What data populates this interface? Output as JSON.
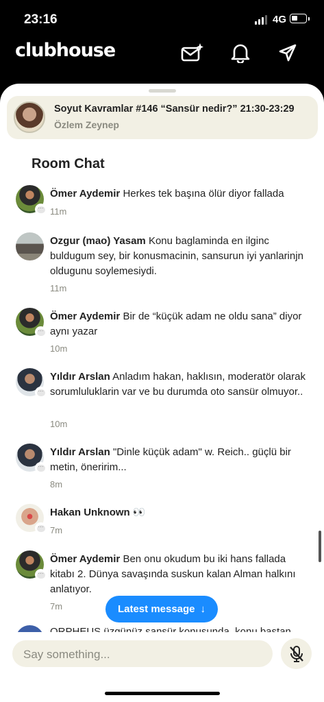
{
  "status": {
    "time": "23:16",
    "network": "4G",
    "battery_level": 0.3
  },
  "app": {
    "logo": "clubhouse"
  },
  "top_icons": [
    "new-message-icon",
    "bell-icon",
    "send-icon"
  ],
  "room": {
    "title": "Soyut Kavramlar #146 “Sansür nedir?” 21:30-23:29",
    "host": "Özlem Zeynep"
  },
  "chat": {
    "heading": "Room Chat",
    "messages": [
      {
        "name": "Ömer Aydemir",
        "text": "Herkes tek başına ölür diyor fallada",
        "time": "11m"
      },
      {
        "name": "Ozgur (mao) Yasam",
        "text": "Konu baglaminda en ilginc buldugum sey, bir konusmacinin, sansurun iyi yanlarinjn oldugunu soylemesiydi.",
        "time": "11m"
      },
      {
        "name": "Ömer Aydemir",
        "text": "Bir de “küçük adam ne oldu sana” diyor aynı yazar",
        "time": "10m"
      },
      {
        "name": "Yıldır Arslan",
        "text": "Anladım hakan, haklısın, moderatör olarak sorumluluklarin var ve bu durumda oto sansür olmuyor..",
        "time": "10m"
      },
      {
        "name": "Yıldır Arslan",
        "text": "\"Dinle küçük adam\" w. Reich.. güçlü bir metin, öneririm...",
        "time": "8m"
      },
      {
        "name": "Hakan Unknown",
        "text": "👀",
        "time": "7m"
      },
      {
        "name": "Ömer Aydemir",
        "text": "Ben onu okudum bu iki hans fallada kitabı 2. Dünya savaşında suskun kalan Alman halkını anlatıyor.",
        "time": "7m"
      }
    ],
    "cutoff_text": "ORPHEUS üzgünüz sansür konusunda, konu baştan"
  },
  "latest_button": "Latest message",
  "input": {
    "placeholder": "Say something..."
  },
  "colors": {
    "accent": "#1a8cff",
    "card": "#f2f0e4",
    "muted": "#8a8a80"
  }
}
